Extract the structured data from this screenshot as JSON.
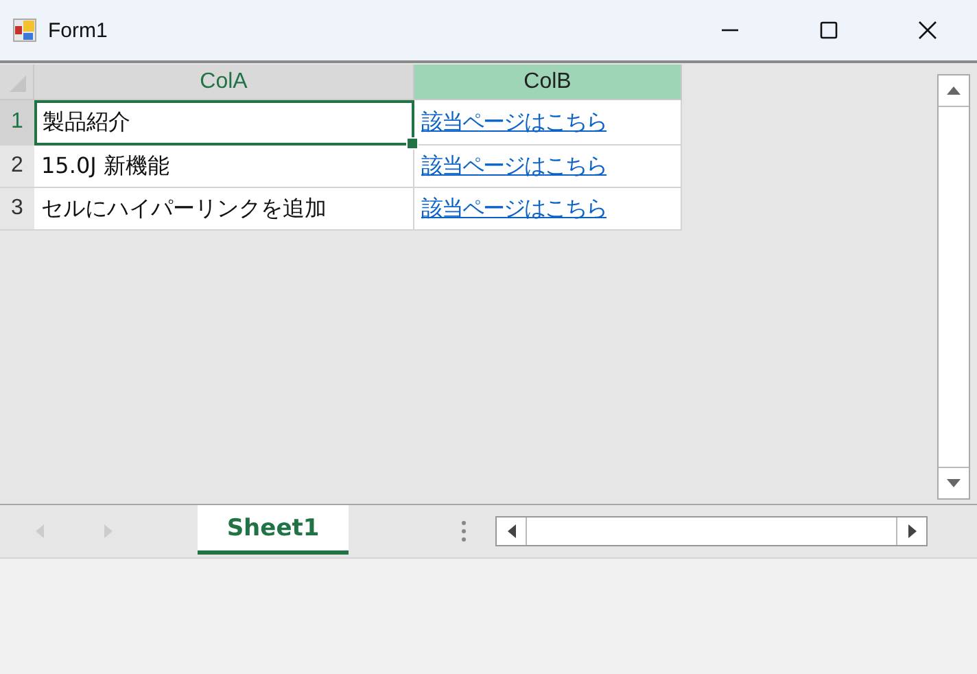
{
  "window": {
    "title": "Form1"
  },
  "sheet": {
    "columns": [
      {
        "label": "ColA",
        "selected": true,
        "hovered": false
      },
      {
        "label": "ColB",
        "selected": false,
        "hovered": true
      }
    ],
    "rows": [
      {
        "header": "1",
        "selected": true,
        "cells": [
          {
            "kind": "text",
            "text": "製品紹介",
            "selected": true
          },
          {
            "kind": "link",
            "text": "該当ページはこちら",
            "selected": false
          }
        ]
      },
      {
        "header": "2",
        "selected": false,
        "cells": [
          {
            "kind": "text",
            "text": "15.0J 新機能",
            "selected": false
          },
          {
            "kind": "link",
            "text": "該当ページはこちら",
            "selected": false
          }
        ]
      },
      {
        "header": "3",
        "selected": false,
        "cells": [
          {
            "kind": "text",
            "text": "セルにハイパーリンクを追加",
            "selected": false
          },
          {
            "kind": "link",
            "text": "該当ページはこちら",
            "selected": false
          }
        ]
      }
    ]
  },
  "tabs": [
    {
      "label": "Sheet1",
      "selected": true
    }
  ]
}
